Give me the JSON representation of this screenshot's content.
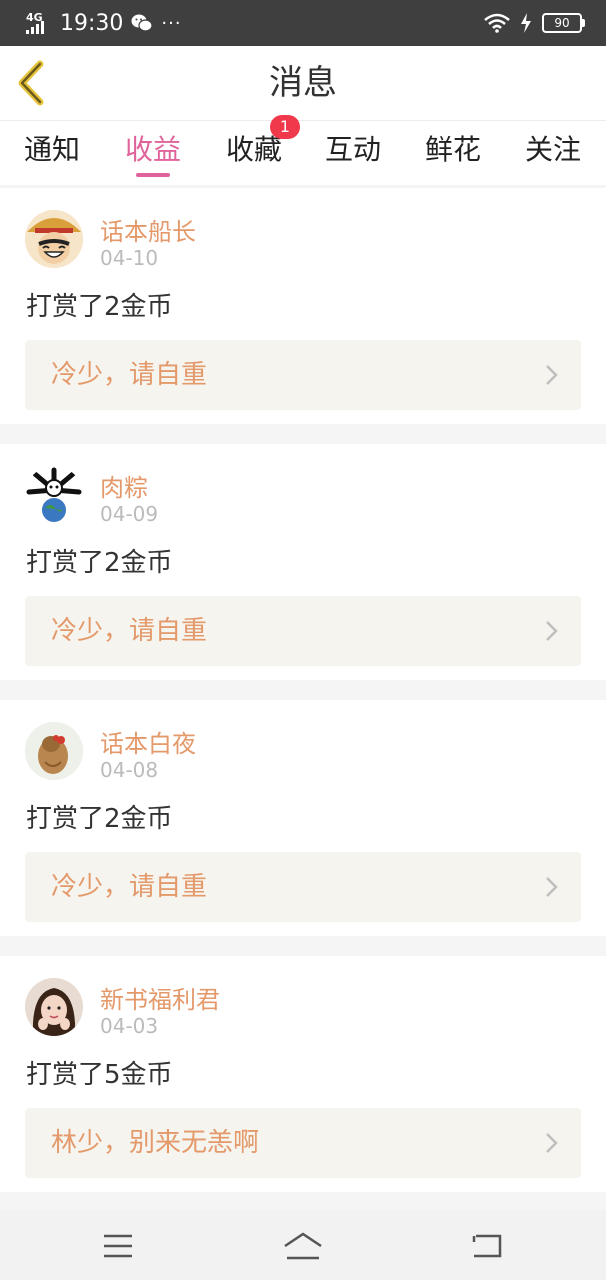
{
  "status_bar": {
    "network": "4G",
    "time": "19:30",
    "more": "···",
    "battery": "90"
  },
  "header": {
    "title": "消息"
  },
  "tabs": [
    {
      "label": "通知",
      "active": false
    },
    {
      "label": "收益",
      "active": true
    },
    {
      "label": "收藏",
      "active": false,
      "badge": "1"
    },
    {
      "label": "互动",
      "active": false
    },
    {
      "label": "鲜花",
      "active": false
    },
    {
      "label": "关注",
      "active": false
    }
  ],
  "messages": [
    {
      "name": "话本船长",
      "date": "04-10",
      "text": "打赏了2金币",
      "quote": "冷少，请自重",
      "avatar": "straw-hat-cartoon-avatar"
    },
    {
      "name": "肉粽",
      "date": "04-09",
      "text": "打赏了2金币",
      "quote": "冷少，请自重",
      "avatar": "panda-earth-avatar"
    },
    {
      "name": "话本白夜",
      "date": "04-08",
      "text": "打赏了2金币",
      "quote": "冷少，请自重",
      "avatar": "hair-bun-avatar"
    },
    {
      "name": "新书福利君",
      "date": "04-03",
      "text": "打赏了5金币",
      "quote": "林少，别来无恙啊",
      "avatar": "girl-photo-avatar"
    }
  ],
  "colors": {
    "accent": "#e0649b",
    "name": "#e4996a",
    "badge": "#f0394a",
    "back_arrow": "#e7c33b"
  }
}
